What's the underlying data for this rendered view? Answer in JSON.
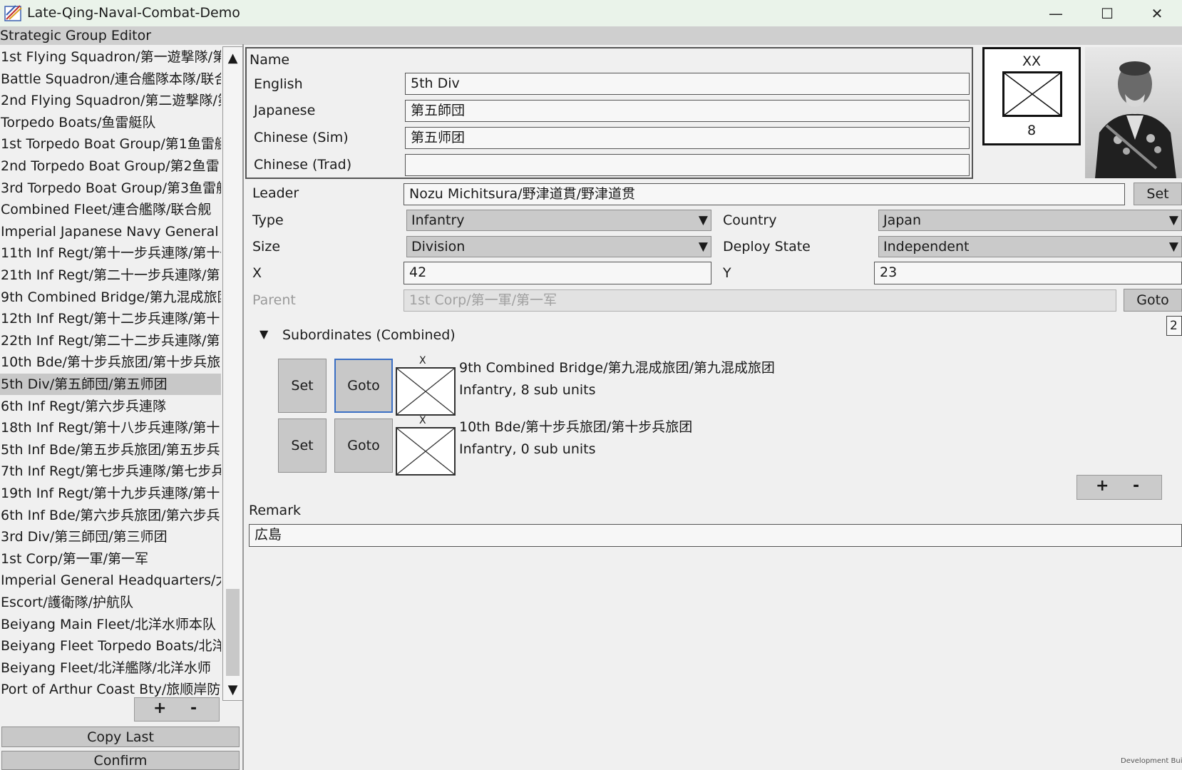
{
  "window": {
    "title": "Late-Qing-Naval-Combat-Demo",
    "minimize_glyph": "—",
    "maximize_glyph": "☐",
    "close_glyph": "✕"
  },
  "panel": {
    "title": "Strategic Group Editor"
  },
  "group_list": {
    "items": [
      "1st Flying Squadron/第一遊撃隊/第",
      "Battle Squadron/連合艦隊本隊/联合",
      "2nd Flying Squadron/第二遊撃隊/第",
      "Torpedo Boats/鱼雷艇队",
      "1st Torpedo Boat Group/第1鱼雷艇",
      "2nd Torpedo Boat Group/第2鱼雷",
      "3rd Torpedo Boat Group/第3鱼雷艇",
      "Combined Fleet/連合艦隊/联合舰",
      "Imperial Japanese Navy General S",
      "11th Inf Regt/第十一步兵連隊/第十一",
      "21th Inf Regt/第二十一步兵連隊/第",
      "9th Combined Bridge/第九混成旅团",
      "12th Inf Regt/第十二步兵連隊/第十",
      "22th Inf Regt/第二十二步兵連隊/第",
      "10th Bde/第十步兵旅团/第十步兵旅",
      "5th Div/第五師団/第五师团",
      "6th Inf Regt/第六步兵連隊",
      "18th Inf Regt/第十八步兵連隊/第十",
      "5th Inf Bde/第五步兵旅团/第五步兵",
      "7th Inf Regt/第七步兵連隊/第七步兵",
      "19th Inf Regt/第十九步兵連隊/第十",
      "6th Inf Bde/第六步兵旅团/第六步兵",
      "3rd Div/第三師団/第三师团",
      "1st Corp/第一軍/第一军",
      "Imperial General Headquarters/大",
      "Escort/護衛隊/护航队",
      "Beiyang Main Fleet/北洋水师本队",
      "Beiyang Fleet Torpedo Boats/北洋",
      "Beiyang Fleet/北洋艦隊/北洋水师",
      "Port of Arthur Coast Bty/旅顺岸防"
    ],
    "selected_index": 15,
    "scroll_up_glyph": "▲",
    "scroll_down_glyph": "▼",
    "add_label": "+",
    "remove_label": "-",
    "copy_last_label": "Copy Last",
    "confirm_label": "Confirm"
  },
  "name_section": {
    "heading": "Name",
    "english_label": "English",
    "english_value": "5th Div",
    "japanese_label": "Japanese",
    "japanese_value": "第五師団",
    "chinese_sim_label": "Chinese (Sim)",
    "chinese_sim_value": "第五师团",
    "chinese_trad_label": "Chinese (Trad)",
    "chinese_trad_value": ""
  },
  "unit_symbol": {
    "size_mark": "XX",
    "strength": "8"
  },
  "leader": {
    "label": "Leader",
    "value": "Nozu Michitsura/野津道貫/野津道贯",
    "set_label": "Set"
  },
  "type": {
    "label": "Type",
    "value": "Infantry"
  },
  "country": {
    "label": "Country",
    "value": "Japan"
  },
  "size": {
    "label": "Size",
    "value": "Division"
  },
  "deploy_state": {
    "label": "Deploy State",
    "value": "Independent"
  },
  "x": {
    "label": "X",
    "value": "42"
  },
  "y": {
    "label": "Y",
    "value": "23"
  },
  "parent": {
    "label": "Parent",
    "value": "1st Corp/第一軍/第一军",
    "goto_label": "Goto"
  },
  "side_counter": "2",
  "subordinates": {
    "toggle_glyph": "▼",
    "heading": "Subordinates (Combined)",
    "items": [
      {
        "name": "9th Combined Bridge/第九混成旅团/第九混成旅团",
        "detail": "Infantry, 8 sub units",
        "size_mark": "X",
        "set_label": "Set",
        "goto_label": "Goto"
      },
      {
        "name": "10th Bde/第十步兵旅团/第十步兵旅团",
        "detail": "Infantry, 0 sub units",
        "size_mark": "X",
        "set_label": "Set",
        "goto_label": "Goto"
      }
    ],
    "add_label": "+",
    "remove_label": "-"
  },
  "remark": {
    "label": "Remark",
    "value": "広島"
  },
  "watermark": "Development Build",
  "colors": {
    "titlebar_bg": "#eaf3ea",
    "panel_bg": "#f0f0f0",
    "button_bg": "#c8c8c8",
    "selected_bg": "#c8c8c8"
  }
}
